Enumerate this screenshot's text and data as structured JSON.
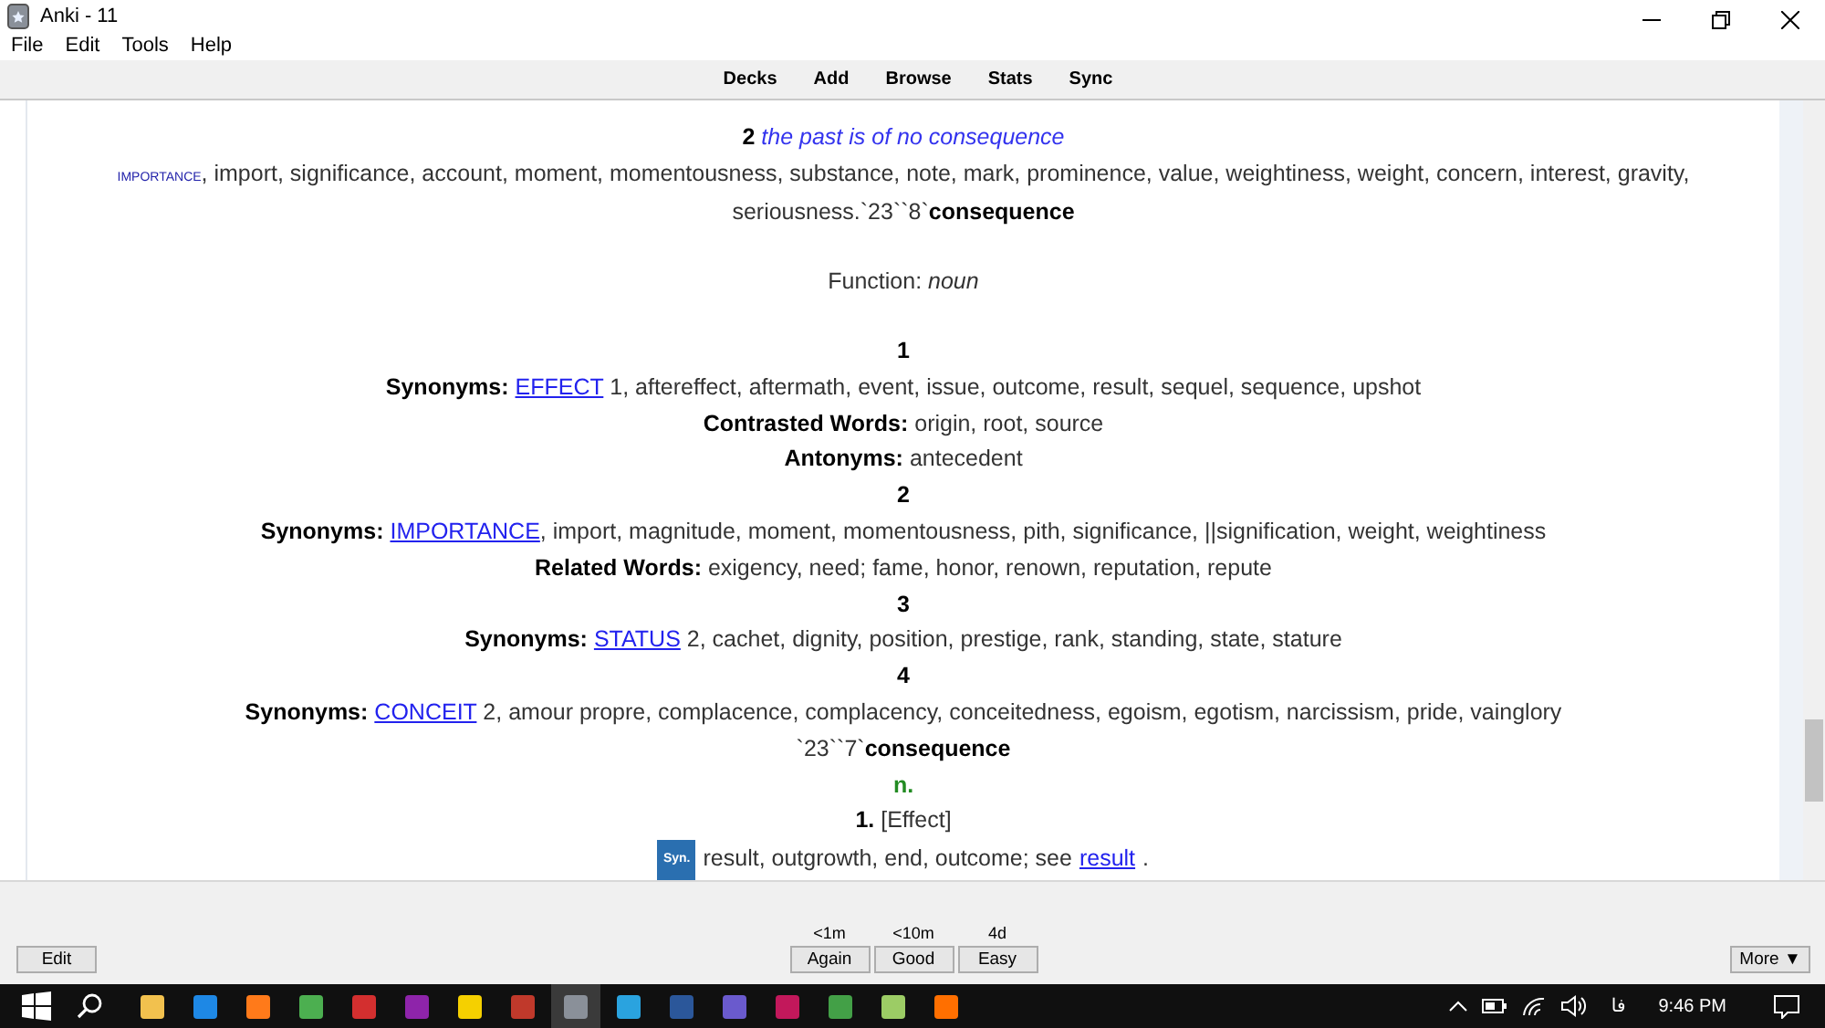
{
  "window": {
    "title": "Anki - 11"
  },
  "menu": [
    "File",
    "Edit",
    "Tools",
    "Help"
  ],
  "toolbar": [
    "Decks",
    "Add",
    "Browse",
    "Stats",
    "Sync"
  ],
  "card": [
    {
      "kind": "example",
      "num": "2",
      "text": "the past is of no consequence"
    },
    {
      "kind": "smallcaps",
      "head": "importance",
      "text": ", import, significance, account, moment, momentousness, substance, note, mark, prominence, value, weightiness, weight, concern, interest, gravity, seriousness.`23``8`**consequence**"
    },
    {
      "kind": "spacer"
    },
    {
      "kind": "plain",
      "text": "Function: *noun*"
    },
    {
      "kind": "spacer"
    },
    {
      "kind": "plain",
      "text": "**1**"
    },
    {
      "kind": "syn",
      "label": "Synonyms:",
      "link": "EFFECT",
      "text": " 1, aftereffect, aftermath, event, issue, outcome, result, sequel, sequence, upshot"
    },
    {
      "kind": "plain",
      "text": "**Contrasted Words:** origin, root, source"
    },
    {
      "kind": "plain",
      "text": "**Antonyms:** antecedent"
    },
    {
      "kind": "plain",
      "text": "**2**"
    },
    {
      "kind": "syn",
      "label": "Synonyms:",
      "link": "IMPORTANCE",
      "text": ", import, magnitude, moment, momentousness, pith, significance, ||signification, weight, weightiness"
    },
    {
      "kind": "plain",
      "text": "**Related Words:** exigency, need; fame, honor, renown, reputation, repute"
    },
    {
      "kind": "plain",
      "text": "**3**"
    },
    {
      "kind": "syn",
      "label": "Synonyms:",
      "link": "STATUS",
      "text": " 2, cachet, dignity, position, prestige, rank, standing, state, stature"
    },
    {
      "kind": "plain",
      "text": "**4**"
    },
    {
      "kind": "syn",
      "label": "Synonyms:",
      "link": "CONCEIT",
      "text": " 2, amour propre, complacence, complacency, conceitedness, egoism, egotism, narcissism, pride, vainglory"
    },
    {
      "kind": "plain",
      "text": "`23``7`**consequence**"
    },
    {
      "kind": "pos",
      "text": "n."
    },
    {
      "kind": "plain",
      "text": "**1.** [Effect]"
    },
    {
      "kind": "badge",
      "badge": "Syn.",
      "text": "result, outgrowth, end, outcome; see",
      "link": "result",
      "tail": "."
    }
  ],
  "bottom": {
    "edit": "Edit",
    "answers": [
      {
        "interval": "<1m",
        "label": "Again"
      },
      {
        "interval": "<10m",
        "label": "Good"
      },
      {
        "interval": "4d",
        "label": "Easy"
      }
    ],
    "more": "More ▼"
  },
  "taskbar": {
    "language": "فا",
    "clock": "9:46 PM"
  }
}
